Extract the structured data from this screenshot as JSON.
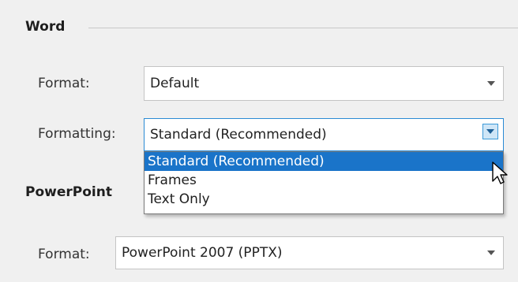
{
  "word": {
    "title": "Word",
    "format_label": "Format:",
    "format_value": "Default",
    "formatting_label": "Formatting:",
    "formatting_value": "Standard (Recommended)",
    "formatting_options": [
      "Standard (Recommended)",
      "Frames",
      "Text Only"
    ],
    "selected_option": "Standard (Recommended)"
  },
  "powerpoint": {
    "title": "PowerPoint",
    "format_label": "Format:",
    "format_value": "PowerPoint 2007 (PPTX)"
  },
  "icons": [
    "chevron-down-icon",
    "mouse-pointer-icon"
  ],
  "colors": {
    "accent": "#2a8ad4",
    "selection": "#1a74c9",
    "background": "#f0f0f0"
  }
}
